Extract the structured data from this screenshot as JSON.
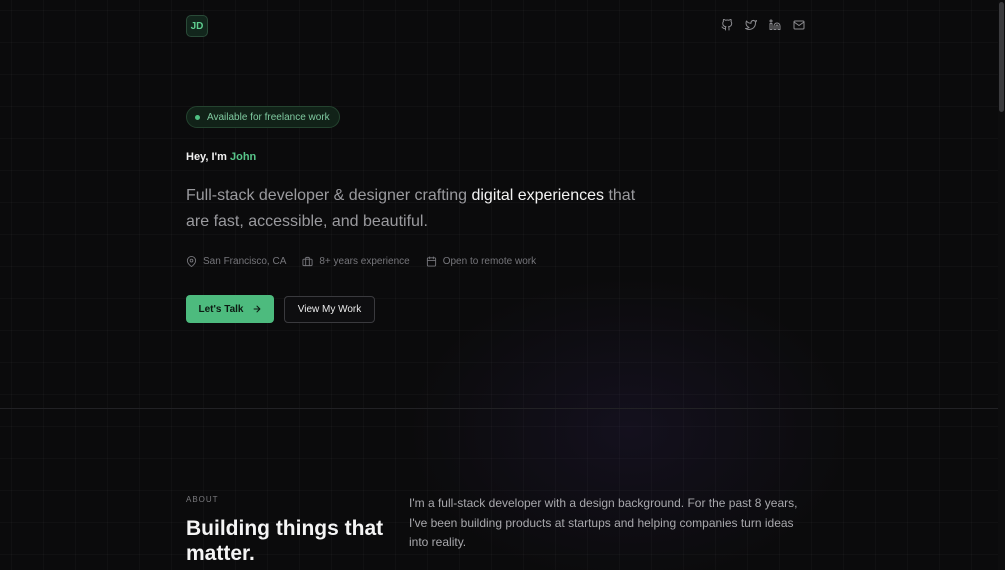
{
  "header": {
    "logo_text": "JD",
    "social": [
      {
        "icon": "github-icon"
      },
      {
        "icon": "twitter-icon"
      },
      {
        "icon": "linkedin-icon"
      },
      {
        "icon": "mail-icon"
      }
    ]
  },
  "hero": {
    "availability": "Available for freelance work",
    "greeting_prefix": "Hey, I'm ",
    "greeting_name": "John",
    "headline_part1": "Full-stack developer & designer crafting ",
    "headline_highlight": "digital experiences",
    "headline_part2": " that are fast, accessible, and beautiful.",
    "meta": {
      "location": "San Francisco, CA",
      "experience": "8+ years experience",
      "availability": "Open to remote work"
    },
    "cta_primary": "Let's Talk",
    "cta_secondary": "View My Work"
  },
  "about": {
    "label": "ABOUT",
    "title": "Building things that matter.",
    "text": "I'm a full-stack developer with a design background. For the past 8 years, I've been building products at startups and helping companies turn ideas into reality."
  },
  "colors": {
    "background": "#0b0b0c",
    "accent": "#4dbb7e",
    "accent_text": "#58c68a"
  }
}
